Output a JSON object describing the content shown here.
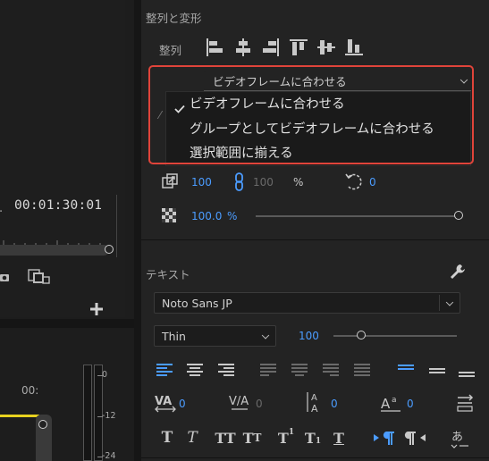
{
  "program": {
    "timecode": "00:01:30:01",
    "seq_time": "00:"
  },
  "meter": {
    "ticks": [
      "0",
      "-12",
      "-24"
    ]
  },
  "align_section": {
    "title": "整列と変形",
    "align_label": "整列",
    "align_to_value": "ビデオフレームに合わせる",
    "menu_items": [
      "ビデオフレームに合わせる",
      "グループとしてビデオフレームに合わせる",
      "選択範囲に揃える"
    ],
    "checked_index": 0,
    "scale_value": "100",
    "scale_height_value": "100",
    "percent": "%",
    "rotation_value": "0",
    "opacity_value": "100.0",
    "opacity_unit": "%",
    "opacity_level_percent": 100
  },
  "text_section": {
    "title": "テキスト",
    "font_family": "Noto Sans JP",
    "font_style": "Thin",
    "font_size": "100",
    "font_size_slider_percent": 22,
    "tracking_value": "0",
    "kerning_value": "0",
    "leading_value": "0",
    "baseline_shift_value": "0"
  },
  "colors": {
    "accent": "#4b9cff",
    "highlight_border": "#e0443a",
    "panel_bg": "#232323"
  }
}
